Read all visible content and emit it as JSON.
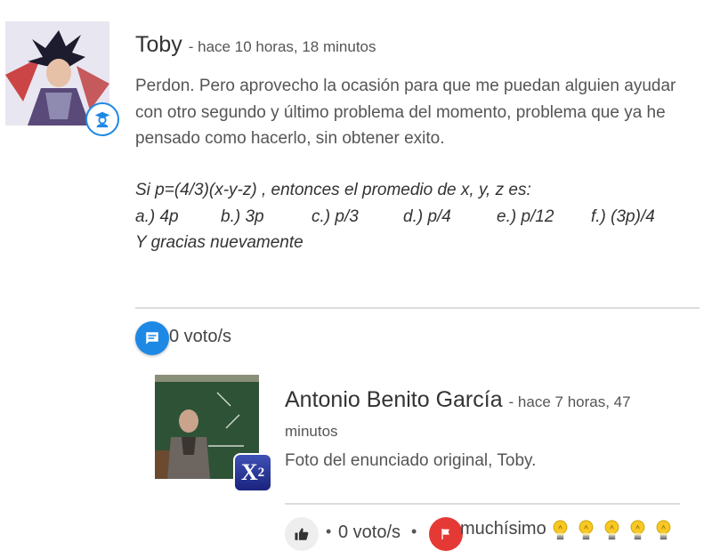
{
  "post": {
    "author": "Toby",
    "time": "- hace 10 horas, 18 minutos",
    "body": "Perdon. Pero aprovecho la ocasión para que me puedan alguien ayudar con otro segundo y último problema del momento, problema que ya he pensado como hacerlo, sin obtener exito.",
    "math_line": "Si  p=(4/3)(x-y-z)  , entonces el promedio de x, y, z es:",
    "options": [
      "a.) 4p",
      "b.) 3p",
      "c.)  p/3",
      "d.) p/4",
      "e.) p/12",
      "f.) (3p)/4"
    ],
    "closing": "Y gracias nuevamente",
    "votes": "0 voto/s",
    "avatar_icon": "anime-character-avatar",
    "badge_icon": "student-icon"
  },
  "reply": {
    "author": "Antonio Benito García",
    "time": "- hace 7 horas, 47 minutos",
    "body": "Foto del enunciado original, Toby.",
    "votes": "0 voto/s",
    "badge_text": "X",
    "badge_sup": "2",
    "rating_label": "muchísimo",
    "rating_bulbs": 5,
    "avatar_icon": "teacher-photo-avatar"
  },
  "separator": "•",
  "colors": {
    "accent_blue": "#1e88e5",
    "flag_red": "#e53935",
    "bulb_yellow": "#f9c825",
    "badge_navy": "#283593"
  }
}
